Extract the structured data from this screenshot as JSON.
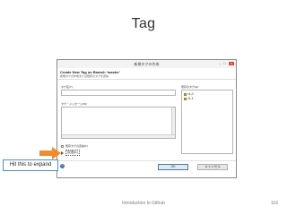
{
  "slide": {
    "title": "Tag",
    "callout": "Hit this to expand",
    "footer_text": "Introduction to Github",
    "page_number": "116"
  },
  "dialog": {
    "window_title": "新規タグの作成",
    "header_title": "Create New Tag on Branch 'master'",
    "header_description": "新規タグの作成または既存のタグを置換",
    "tag_name_label": "タグ名(T):",
    "tag_message_label": "タグ・メッセージ(M):",
    "existing_tags_label": "既存のタグ(E):",
    "existing_tags": [
      "v1.0",
      "v1.1"
    ],
    "overwrite_checkbox_label": "既存タグの置換(F)",
    "advanced_label": "拡張(A)",
    "help_symbol": "?",
    "ok_label": "OK",
    "cancel_label": "キャンセル"
  },
  "colors": {
    "callout_border": "#4f8ccf",
    "arrow_fill": "#f08c2c",
    "help_icon": "#3b74b8",
    "close_button": "#d54c3b"
  },
  "icons": [
    "tag-icon",
    "help-icon",
    "expand-arrow-icon",
    "minimize-icon",
    "maximize-icon",
    "close-icon"
  ]
}
